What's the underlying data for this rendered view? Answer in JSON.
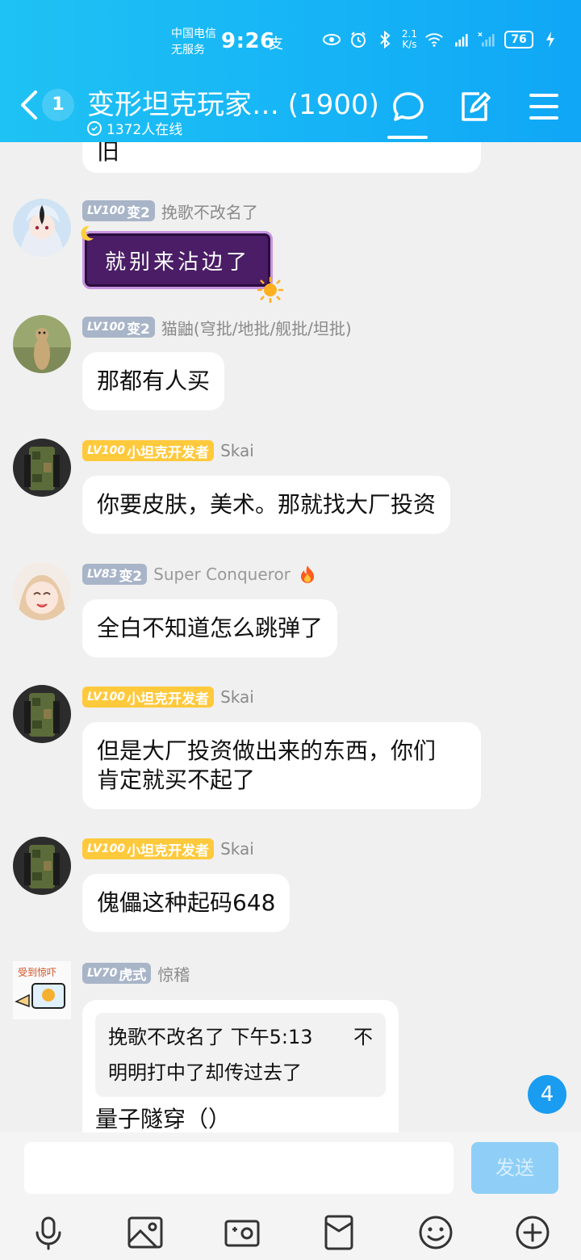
{
  "status_bar": {
    "carrier_line1": "中国电信",
    "carrier_line2": "无服务",
    "time": "9:26",
    "misc": "支",
    "net_speed_value": "2.1",
    "net_speed_unit": "K/s",
    "battery": "76"
  },
  "header": {
    "unread_count": "1",
    "title": "变形坦克玩家… (1900)",
    "online": "1372人在线"
  },
  "messages": [
    {
      "partial_text": "旧"
    },
    {
      "level": "LV100",
      "title_tag": "变2",
      "tag_style": "gray",
      "nickname": "挽歌不改名了",
      "sticker_text": "就别来沾边了"
    },
    {
      "level": "LV100",
      "title_tag": "变2",
      "tag_style": "gray",
      "nickname": "猫鼬(穹批/地批/舰批/坦批)",
      "text": "那都有人买"
    },
    {
      "level": "LV100",
      "title_tag": "小坦克开发者",
      "tag_style": "gold",
      "nickname": "Skai",
      "text": "你要皮肤，美术。那就找大厂投资"
    },
    {
      "level": "LV83",
      "title_tag": "变2",
      "tag_style": "gray",
      "nickname": "Super Conqueror",
      "text": "全白不知道怎么跳弹了"
    },
    {
      "level": "LV100",
      "title_tag": "小坦克开发者",
      "tag_style": "gold",
      "nickname": "Skai",
      "text_line1": "但是大厂投资做出来的东西，你们",
      "text_line2": "肯定就买不起了"
    },
    {
      "level": "LV100",
      "title_tag": "小坦克开发者",
      "tag_style": "gold",
      "nickname": "Skai",
      "text": "傀儡这种起码648"
    },
    {
      "level": "LV70",
      "title_tag": "虎式",
      "tag_style": "gray",
      "nickname": "惊稽",
      "quote_author": "挽歌不改名了 下午5:13",
      "quote_trail": "不",
      "quote_text": "明明打中了却传过去了",
      "text_partial": "量子隧穿（）"
    }
  ],
  "new_message_count": "4",
  "composer": {
    "input_value": "",
    "send_label": "发送"
  },
  "colors": {
    "header_start": "#1fc2f4",
    "header_end": "#10a7f6",
    "tag_gray": "#a8b4c8",
    "tag_gold": "#ffc93c",
    "badge_blue": "#1a9cf0",
    "send_disabled": "#8fcff7"
  },
  "icons": {
    "toolbar": [
      "microphone-icon",
      "image-icon",
      "camera-icon",
      "red-packet-icon",
      "emoji-icon",
      "plus-icon"
    ],
    "nav": [
      "back-icon",
      "chat-bubble-icon",
      "edit-icon",
      "menu-icon"
    ]
  }
}
